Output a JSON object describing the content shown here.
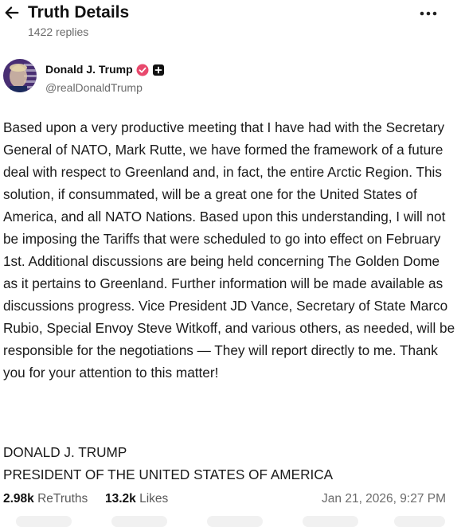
{
  "header": {
    "title": "Truth Details",
    "replies": "1422 replies"
  },
  "author": {
    "name": "Donald J. Trump",
    "handle": "@realDonaldTrump"
  },
  "post": {
    "body": "Based upon a very productive meeting that I have had with the Secretary General of NATO, Mark Rutte, we have formed the framework of a future deal with respect to Greenland and, in fact, the entire Arctic Region. This solution, if consummated, will be a great one for the United States of America, and all NATO Nations. Based upon this understanding, I will not be imposing the Tariffs that were scheduled to go into effect on February 1st. Additional discussions are being held concerning The Golden Dome as it pertains to Greenland. Further information will be made available as discussions progress. Vice President JD Vance, Secretary of State Marco Rubio, Special Envoy Steve Witkoff, and various others, as needed, will be responsible for the negotiations — They will report directly to me. Thank you for your attention to this matter!",
    "signature_line1": "DONALD J. TRUMP",
    "signature_line2": "PRESIDENT OF THE UNITED STATES OF AMERICA"
  },
  "stats": {
    "retruths_count": "2.98k",
    "retruths_label": "ReTruths",
    "likes_count": "13.2k",
    "likes_label": "Likes",
    "timestamp": "Jan 21, 2026, 9:27 PM"
  },
  "icons": {
    "back": "arrow-left-icon",
    "more": "more-horizontal-icon",
    "verified": "verified-badge-icon",
    "plus": "plus-badge-icon"
  },
  "colors": {
    "verified": "#e8496d",
    "muted": "#6b6b6b",
    "text": "#1a1a1a"
  }
}
